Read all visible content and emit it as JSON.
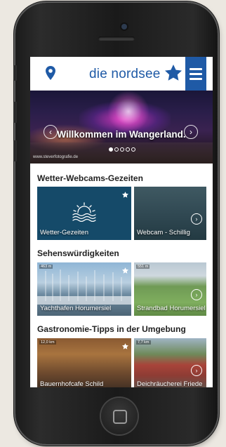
{
  "header": {
    "logo": "die nordsee",
    "icons": [
      "location-pin-icon",
      "star-icon",
      "menu-icon"
    ]
  },
  "hero": {
    "title": "Willkommen im Wangerland.",
    "credit": "www.steverfotografie.de",
    "slides_total": 5,
    "active_slide": 1
  },
  "sections": [
    {
      "title": "Wetter-Webcams-Gezeiten",
      "cards": [
        {
          "label": "Wetter-Gezeiten",
          "icon": "sun-waves-icon",
          "favorite": true
        },
        {
          "label": "Webcam - Schillig",
          "icon": "arrow-right-circle-icon"
        }
      ]
    },
    {
      "title": "Sehenswürdigkeiten",
      "cards": [
        {
          "label": "Yachthafen Horumersiel",
          "distance": "463 m",
          "favorite": true
        },
        {
          "label": "Strandbad Horumersiel",
          "distance": "551 m"
        }
      ]
    },
    {
      "title": "Gastronomie-Tipps in der Umgebung",
      "cards": [
        {
          "label": "Bauernhofcafe Schild",
          "distance": "12,0 km",
          "favorite": true
        },
        {
          "label": "Deichräucherei Friede",
          "distance": "7,7 km"
        }
      ]
    }
  ],
  "colors": {
    "brand_blue": "#1f5aa6",
    "weather_card": "#154a69",
    "background": "#ece8e1"
  }
}
